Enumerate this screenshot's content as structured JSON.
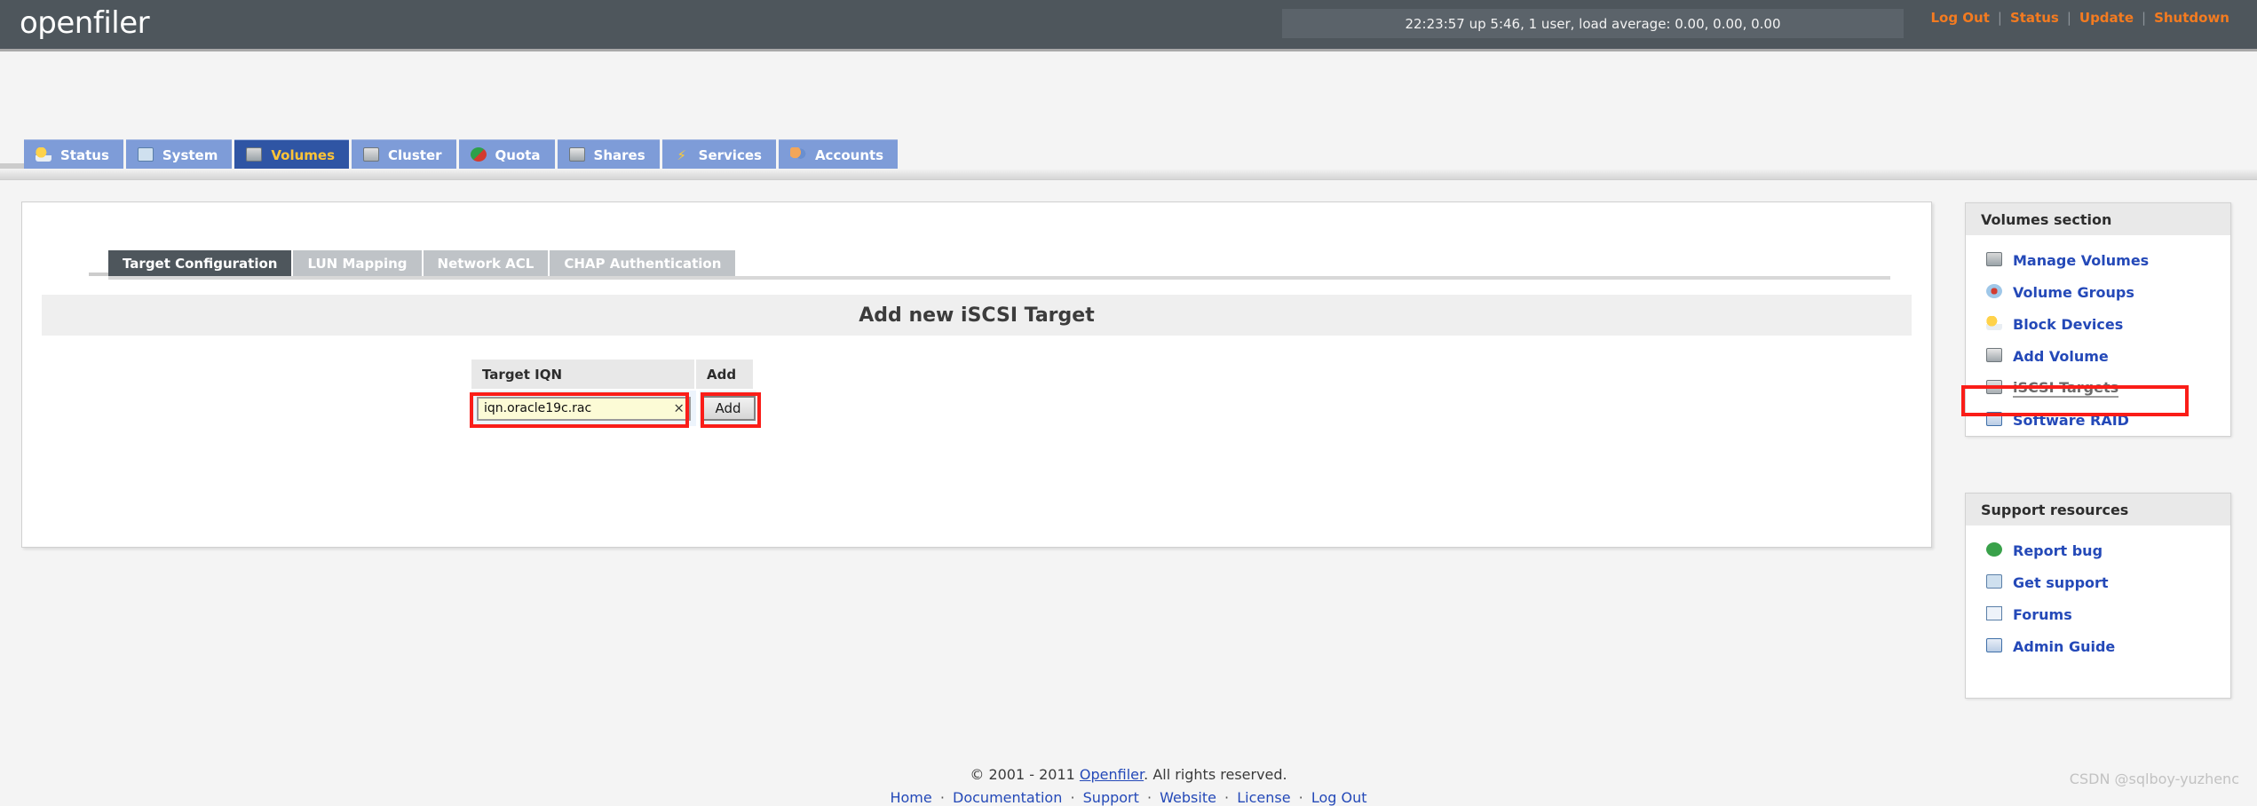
{
  "header": {
    "logo": "openfiler",
    "uptime": "22:23:57 up 5:46, 1 user, load average: 0.00, 0.00, 0.00",
    "links": [
      {
        "label": "Log Out"
      },
      {
        "label": "Status"
      },
      {
        "label": "Update"
      },
      {
        "label": "Shutdown"
      }
    ],
    "separator": "|"
  },
  "main_tabs": [
    {
      "label": "Status",
      "icon": "sun-cloud-icon",
      "active": false
    },
    {
      "label": "System",
      "icon": "monitor-icon",
      "active": false
    },
    {
      "label": "Volumes",
      "icon": "volume-icon",
      "active": true
    },
    {
      "label": "Cluster",
      "icon": "cluster-icon",
      "active": false
    },
    {
      "label": "Quota",
      "icon": "quota-pie-icon",
      "active": false
    },
    {
      "label": "Shares",
      "icon": "share-disk-icon",
      "active": false
    },
    {
      "label": "Services",
      "icon": "lightning-icon",
      "active": false
    },
    {
      "label": "Accounts",
      "icon": "accounts-icon",
      "active": false
    }
  ],
  "sub_tabs": [
    {
      "label": "Target Configuration",
      "active": true
    },
    {
      "label": "LUN Mapping",
      "active": false
    },
    {
      "label": "Network ACL",
      "active": false
    },
    {
      "label": "CHAP Authentication",
      "active": false
    }
  ],
  "section": {
    "title": "Add new iSCSI Target"
  },
  "form": {
    "columns": [
      "Target IQN",
      "Add"
    ],
    "iqn_value": "iqn.oracle19c.rac",
    "iqn_placeholder": "",
    "clear_icon": "×",
    "add_button_label": "Add"
  },
  "sidebar": {
    "volumes_section": {
      "title": "Volumes section",
      "items": [
        {
          "label": "Manage Volumes",
          "icon": "drive-icon",
          "current": false
        },
        {
          "label": "Volume Groups",
          "icon": "volume-group-icon",
          "current": false
        },
        {
          "label": "Block Devices",
          "icon": "block-device-icon",
          "current": false
        },
        {
          "label": "Add Volume",
          "icon": "add-volume-icon",
          "current": false
        },
        {
          "label": "iSCSI Targets",
          "icon": "iscsi-icon",
          "current": true
        },
        {
          "label": "Software RAID",
          "icon": "raid-icon",
          "current": false
        }
      ]
    },
    "support_section": {
      "title": "Support resources",
      "items": [
        {
          "label": "Report bug",
          "icon": "bug-icon"
        },
        {
          "label": "Get support",
          "icon": "support-icon"
        },
        {
          "label": "Forums",
          "icon": "forum-mail-icon"
        },
        {
          "label": "Admin Guide",
          "icon": "book-icon"
        }
      ]
    }
  },
  "footer": {
    "copyright_prefix": "© 2001 - 2011 ",
    "brand_link": "Openfiler",
    "copyright_suffix": ". All rights reserved.",
    "links": [
      "Home",
      "Documentation",
      "Support",
      "Website",
      "License",
      "Log Out"
    ],
    "link_separator": "·"
  },
  "watermark": "CSDN @sqlboy-yuzhenc",
  "colors": {
    "header_bg": "#4e565c",
    "accent_orange": "#f47b20",
    "tab_blue": "#7e9cd8",
    "tab_active_blue": "#2f55a4",
    "tab_active_text": "#ffc436",
    "link_blue": "#2449b8",
    "annotation_red": "#fa1d18",
    "input_yellow": "#fcfbd6"
  }
}
